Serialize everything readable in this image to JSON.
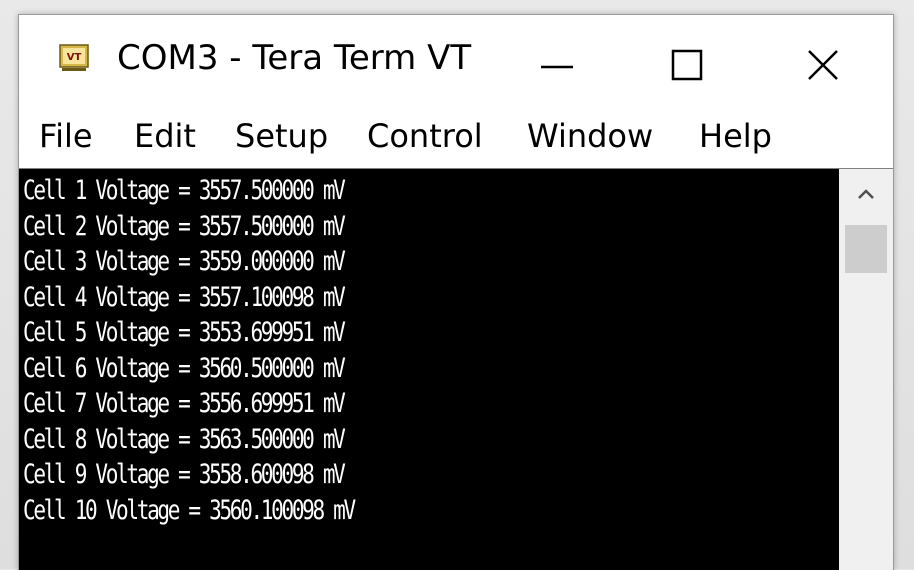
{
  "window": {
    "title": "COM3 - Tera Term VT",
    "app_icon_text": "VT"
  },
  "menu": {
    "items": [
      "File",
      "Edit",
      "Setup",
      "Control",
      "Window",
      "Help"
    ]
  },
  "terminal": {
    "lines": [
      "Cell 1 Voltage = 3557.500000 mV",
      "Cell 2 Voltage = 3557.500000 mV",
      "Cell 3 Voltage = 3559.000000 mV",
      "Cell 4 Voltage = 3557.100098 mV",
      "Cell 5 Voltage = 3553.699951 mV",
      "Cell 6 Voltage = 3560.500000 mV",
      "Cell 7 Voltage = 3556.699951 mV",
      "Cell 8 Voltage = 3563.500000 mV",
      "Cell 9 Voltage = 3558.600098 mV",
      "Cell 10 Voltage = 3560.100098 mV"
    ]
  },
  "colors": {
    "terminal_bg": "#000000",
    "terminal_fg": "#ffffff",
    "window_bg": "#ffffff",
    "scrollbar_bg": "#f0f0f0"
  }
}
